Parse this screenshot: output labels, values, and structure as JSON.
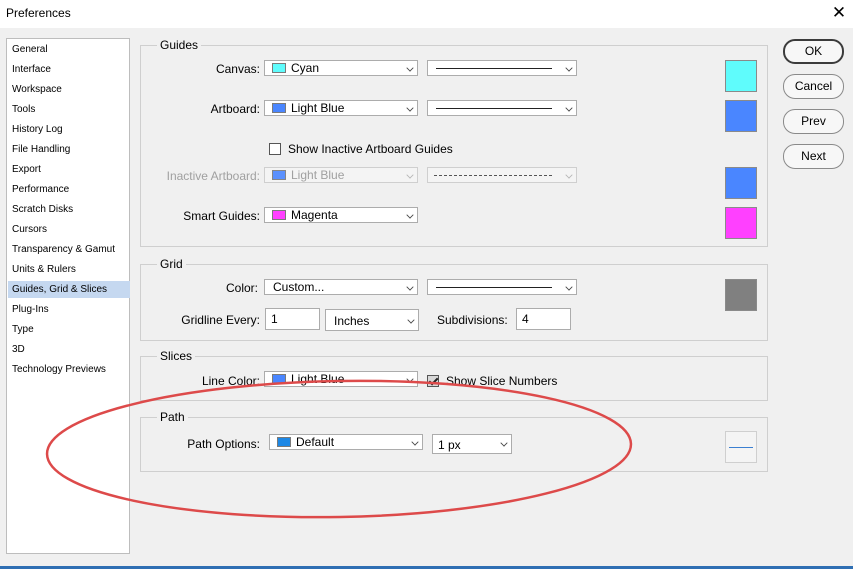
{
  "window": {
    "title": "Preferences",
    "close_label": "✕"
  },
  "sidebar": {
    "items": [
      {
        "label": "General"
      },
      {
        "label": "Interface"
      },
      {
        "label": "Workspace"
      },
      {
        "label": "Tools"
      },
      {
        "label": "History Log"
      },
      {
        "label": "File Handling"
      },
      {
        "label": "Export"
      },
      {
        "label": "Performance"
      },
      {
        "label": "Scratch Disks"
      },
      {
        "label": "Cursors"
      },
      {
        "label": "Transparency & Gamut"
      },
      {
        "label": "Units & Rulers"
      },
      {
        "label": "Guides, Grid & Slices",
        "selected": true
      },
      {
        "label": "Plug-Ins"
      },
      {
        "label": "Type"
      },
      {
        "label": "3D"
      },
      {
        "label": "Technology Previews"
      }
    ]
  },
  "buttons": {
    "ok": "OK",
    "cancel": "Cancel",
    "prev": "Prev",
    "next": "Next"
  },
  "guides": {
    "title": "Guides",
    "canvas": {
      "label": "Canvas:",
      "color": "Cyan",
      "swatch": "#5ffcfc",
      "style": "solid"
    },
    "artboard": {
      "label": "Artboard:",
      "color": "Light Blue",
      "swatch": "#4a86ff",
      "style": "solid"
    },
    "show_inactive": {
      "label": "Show Inactive Artboard Guides",
      "checked": false
    },
    "inactive_artboard": {
      "label": "Inactive Artboard:",
      "color": "Light Blue",
      "swatch": "#4a86ff",
      "style": "dashed",
      "disabled": true
    },
    "smart_guides": {
      "label": "Smart Guides:",
      "color": "Magenta",
      "swatch": "#ff40ff"
    }
  },
  "grid": {
    "title": "Grid",
    "color": {
      "label": "Color:",
      "value": "Custom...",
      "swatch": "#808080",
      "style": "solid"
    },
    "gridline": {
      "label": "Gridline Every:",
      "value": "1",
      "unit": "Inches"
    },
    "subdivisions": {
      "label": "Subdivisions:",
      "value": "4"
    }
  },
  "slices": {
    "title": "Slices",
    "line_color": {
      "label": "Line Color:",
      "color": "Light Blue",
      "swatch": "#4a86ff"
    },
    "show_numbers": {
      "label": "Show Slice Numbers",
      "checked": true
    }
  },
  "path": {
    "title": "Path",
    "options": {
      "label": "Path Options:",
      "color": "Default",
      "swatch": "#1e88e5",
      "width": "1 px"
    },
    "preview_line_color": "#3b7fd1"
  },
  "annotation": {
    "shape": "ellipse",
    "color": "#dd4a4a"
  },
  "colors": {
    "selection": "#c5d8f0",
    "window_bg": "#f0f0f0"
  }
}
